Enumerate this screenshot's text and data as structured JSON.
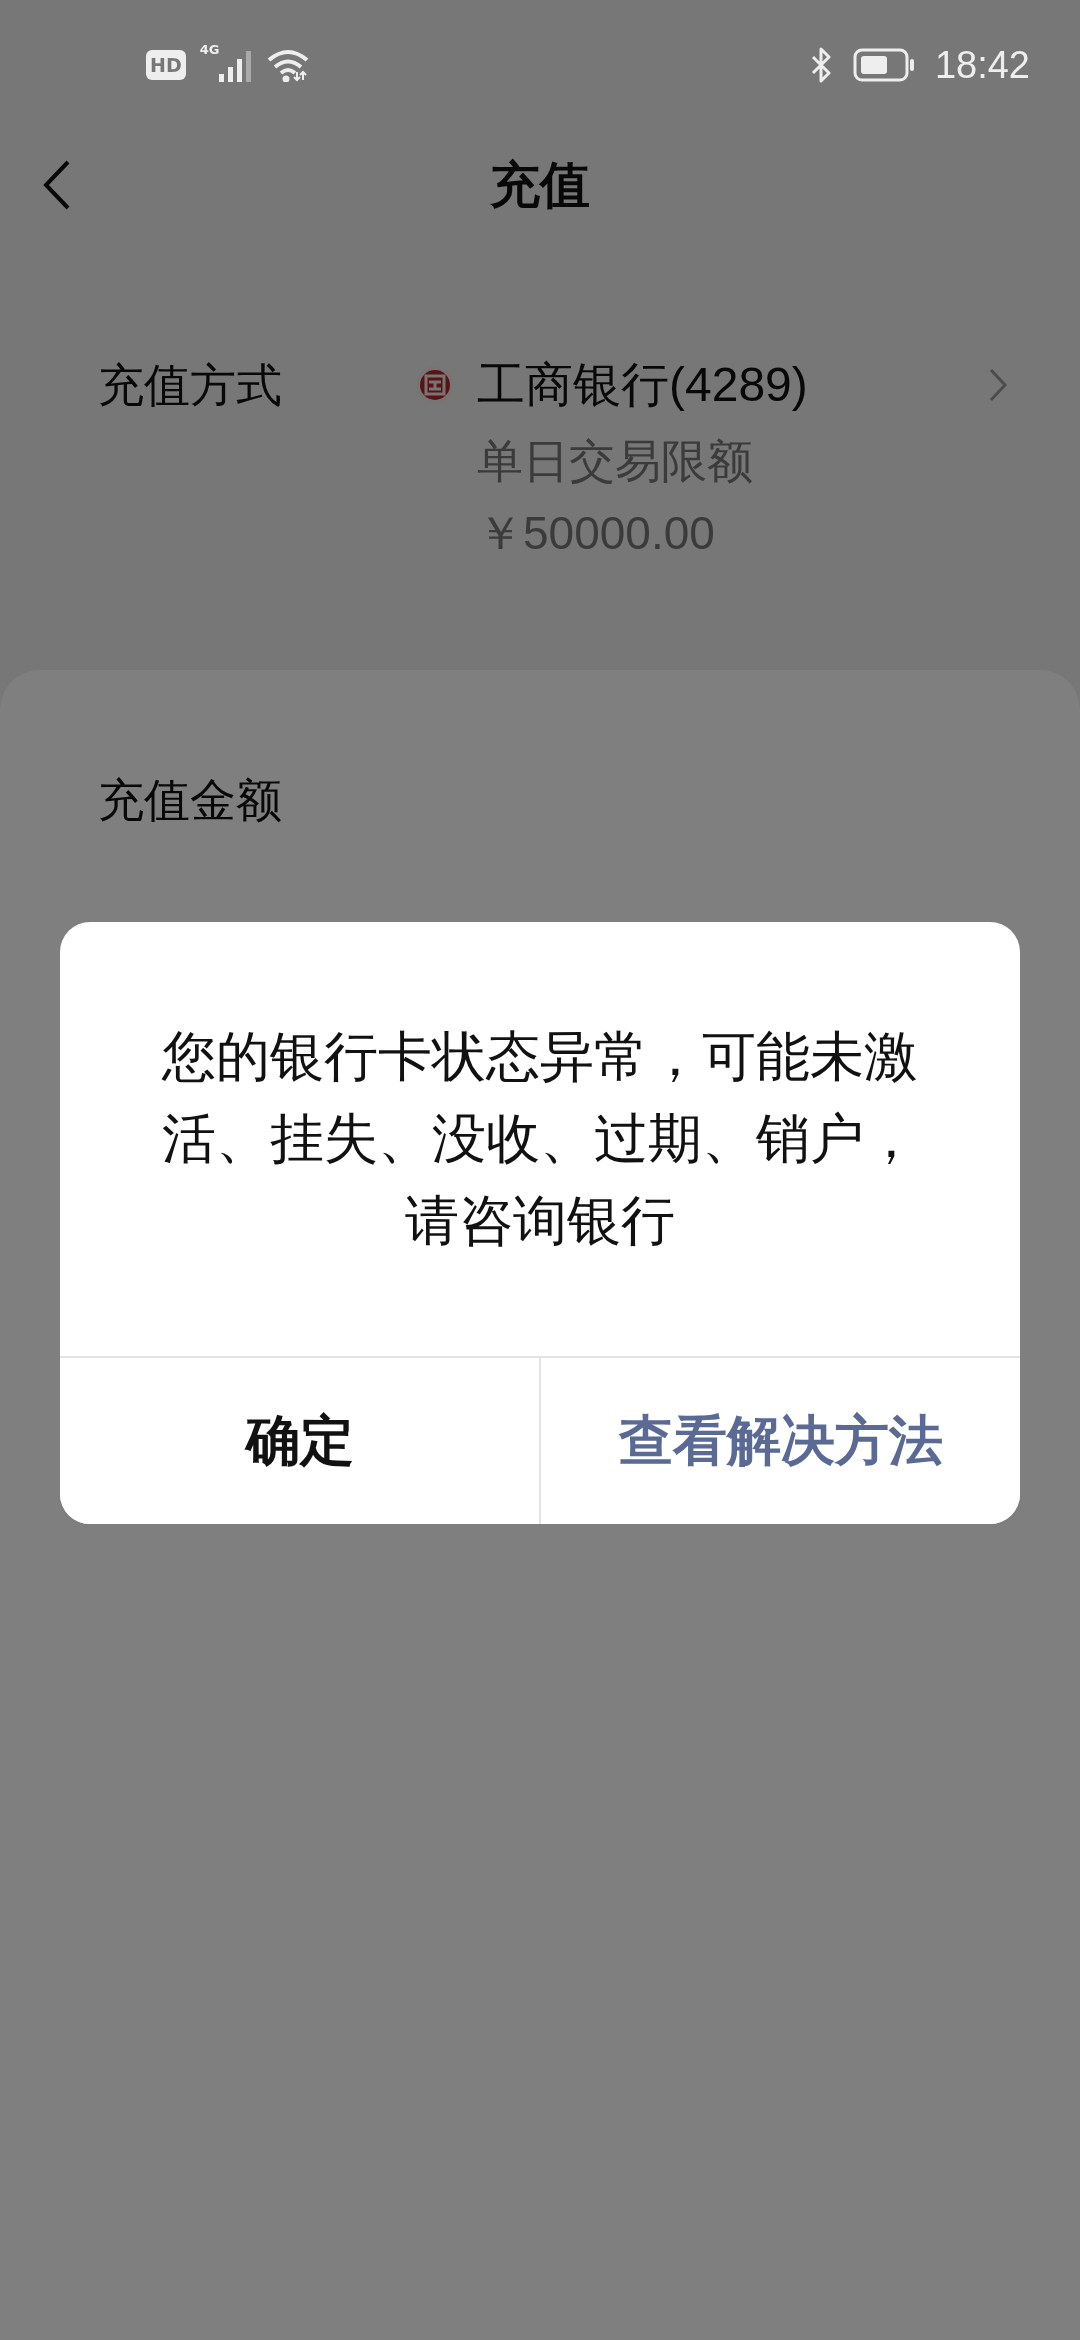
{
  "status_bar": {
    "hd_badge": "HD",
    "network": "4G",
    "time": "18:42"
  },
  "header": {
    "title": "充值"
  },
  "payment_method": {
    "label": "充值方式",
    "bank_name": "工商银行(4289)",
    "limit_label": "单日交易限额",
    "limit_amount": "￥50000.00"
  },
  "amount": {
    "label": "充值金额"
  },
  "dialog": {
    "message": "您的银行卡状态异常，可能未激活、挂失、没收、过期、销户，请咨询银行",
    "buttons": [
      {
        "label": "确定",
        "kind": "default"
      },
      {
        "label": "查看解决方法",
        "kind": "primary"
      }
    ]
  }
}
